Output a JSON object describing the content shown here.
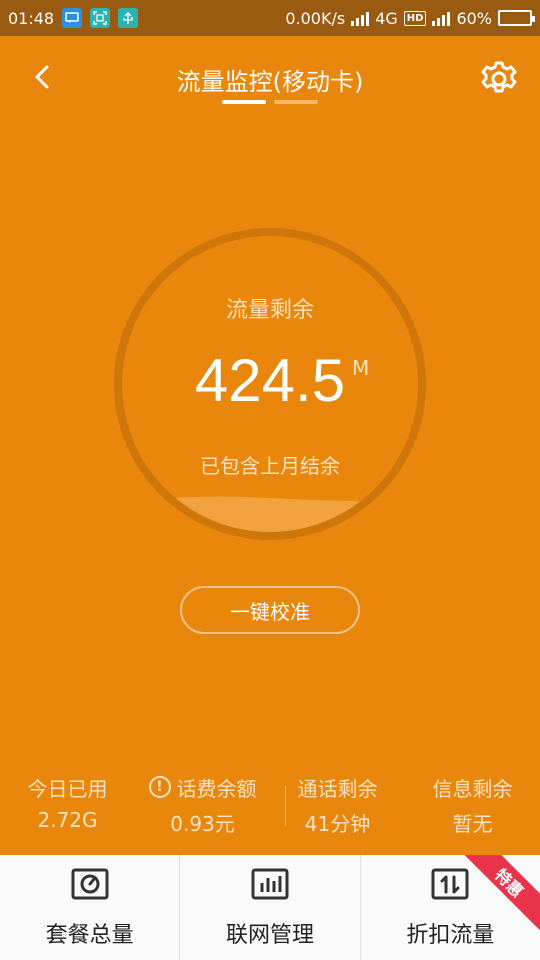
{
  "status_bar": {
    "time": "01:48",
    "network_speed": "0.00K/s",
    "network_type": "4G",
    "hd_badge": "HD",
    "battery_percent": "60%",
    "battery_level": 0.6,
    "icons": [
      "chat-icon",
      "scan-icon",
      "usb-icon"
    ]
  },
  "header": {
    "title": "流量监控(移动卡)",
    "back_icon": "chevron-left-icon",
    "settings_icon": "gear-icon",
    "page_count": 2,
    "active_page": 0
  },
  "data_ring": {
    "label": "流量剩余",
    "value": "424.5",
    "unit": "M",
    "subtitle": "已包含上月结余"
  },
  "calibrate_button": {
    "label": "一键校准"
  },
  "stats": [
    {
      "label": "今日已用",
      "value": "2.72G"
    },
    {
      "label": "话费余额",
      "value": "0.93元",
      "icon": "alert-circle-icon"
    },
    {
      "label": "通话剩余",
      "value": "41分钟"
    },
    {
      "label": "信息剩余",
      "value": "暂无"
    }
  ],
  "bottom_nav": [
    {
      "label": "套餐总量",
      "icon": "gauge-icon"
    },
    {
      "label": "联网管理",
      "icon": "bar-chart-icon"
    },
    {
      "label": "折扣流量",
      "icon": "transfer-icon",
      "ribbon": "特惠"
    }
  ],
  "colors": {
    "background": "#e8870b",
    "status_bar": "#9a5a10",
    "ribbon": "#e8334a",
    "nav_background": "#fafafa"
  }
}
